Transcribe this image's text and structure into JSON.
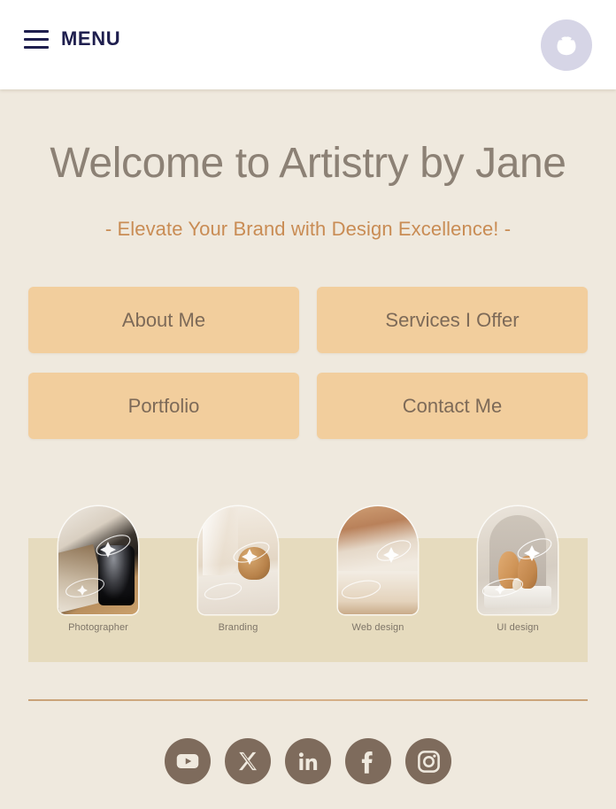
{
  "header": {
    "menu_label": "MENU",
    "menu_icon": "hamburger-icon",
    "avatar_icon": "avatar-circle-icon"
  },
  "hero": {
    "title": "Welcome to Artistry by Jane",
    "subtitle": "- Elevate Your Brand with Design Excellence! -",
    "title_color": "#8C8175",
    "subtitle_color": "#C98C54"
  },
  "nav_buttons": [
    {
      "label": "About Me"
    },
    {
      "label": "Services I Offer"
    },
    {
      "label": "Portfolio"
    },
    {
      "label": "Contact Me"
    }
  ],
  "nav_button_style": {
    "background": "#F2CE9D",
    "text_color": "#7D6A58"
  },
  "portfolio": {
    "band_color": "#E6DBBE",
    "cards": [
      {
        "label": "Photographer",
        "image": "camera-lens-photo"
      },
      {
        "label": "Branding",
        "image": "candles-decor-photo"
      },
      {
        "label": "Web design",
        "image": "bedroom-interior-photo"
      },
      {
        "label": "UI design",
        "image": "terracotta-vases-photo"
      }
    ]
  },
  "divider": {
    "color": "#C9A277"
  },
  "social": {
    "icon_background": "#7E6B5C",
    "items": [
      {
        "name": "youtube",
        "label": "YouTube"
      },
      {
        "name": "x-twitter",
        "label": "X"
      },
      {
        "name": "linkedin",
        "label": "LinkedIn"
      },
      {
        "name": "facebook",
        "label": "Facebook"
      },
      {
        "name": "instagram",
        "label": "Instagram"
      }
    ]
  },
  "page": {
    "background": "#EFE9DE",
    "header_background": "#FFFFFF"
  }
}
